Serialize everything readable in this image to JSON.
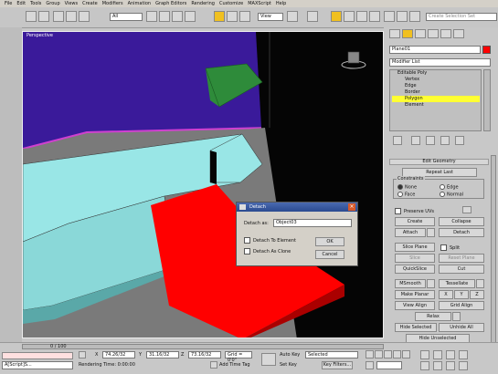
{
  "menu": [
    "File",
    "Edit",
    "Tools",
    "Group",
    "Views",
    "Create",
    "Modifiers",
    "Animation",
    "Graph Editors",
    "Rendering",
    "Customize",
    "MAXScript",
    "Help"
  ],
  "toolbar": {
    "filter_value": "All",
    "view_value": "View",
    "selection_set_placeholder": "Create Selection Set"
  },
  "viewport": {
    "label": "Perspective"
  },
  "panel": {
    "object_name": "Plane01",
    "modifier_list": "Modifier List",
    "stack": [
      {
        "label": "Editable Poly",
        "selected": false,
        "level": 0
      },
      {
        "label": "Vertex",
        "selected": false,
        "level": 1
      },
      {
        "label": "Edge",
        "selected": false,
        "level": 1
      },
      {
        "label": "Border",
        "selected": false,
        "level": 1
      },
      {
        "label": "Polygon",
        "selected": true,
        "level": 1
      },
      {
        "label": "Element",
        "selected": false,
        "level": 1
      }
    ],
    "rollout_title": "Edit Geometry",
    "repeat_last": "Repeat Last",
    "constraints_label": "Constraints",
    "constraint_none": "None",
    "constraint_edge": "Edge",
    "constraint_face": "Face",
    "constraint_normal": "Normal",
    "preserve_uvs": "Preserve UVs",
    "create": "Create",
    "collapse": "Collapse",
    "attach": "Attach",
    "detach": "Detach",
    "slice_plane": "Slice Plane",
    "split": "Split",
    "slice": "Slice",
    "reset_plane": "Reset Plane",
    "quickslice": "QuickSlice",
    "cut": "Cut",
    "msmooth": "MSmooth",
    "tessellate": "Tessellate",
    "make_planar": "Make Planar",
    "x": "X",
    "y": "Y",
    "z": "Z",
    "view_align": "View Align",
    "grid_align": "Grid Align",
    "relax": "Relax",
    "hide_selected": "Hide Selected",
    "unhide_all": "Unhide All",
    "hide_unselected": "Hide Unselected"
  },
  "dialog": {
    "title": "Detach",
    "detach_as_label": "Detach as:",
    "detach_as_value": "Object03",
    "detach_to_element": "Detach To Element",
    "detach_as_clone": "Detach As Clone",
    "ok": "OK",
    "cancel": "Cancel"
  },
  "status": {
    "timeline": "0 / 100",
    "x_value": "74.26/32",
    "y_value": "31.16/32",
    "z_value": "73.16/32",
    "grid": "Grid = 0'0\"",
    "auto_key": "Auto Key",
    "auto_key_value": "Selected",
    "set_key": "Set Key",
    "key_filters": "Key Filters...",
    "rendering_time": "Rendering Time: 0:00:00",
    "add_time_tag": "Add Time Tag",
    "script_field": "A[Script]S..."
  },
  "colors": {
    "selection_red": "#ff0000",
    "mesh_cyan": "#99e6e6",
    "sky_purple": "#3a1a9a",
    "green_blocks": "#2e8b3a",
    "highlight_yellow": "#ffff33"
  }
}
